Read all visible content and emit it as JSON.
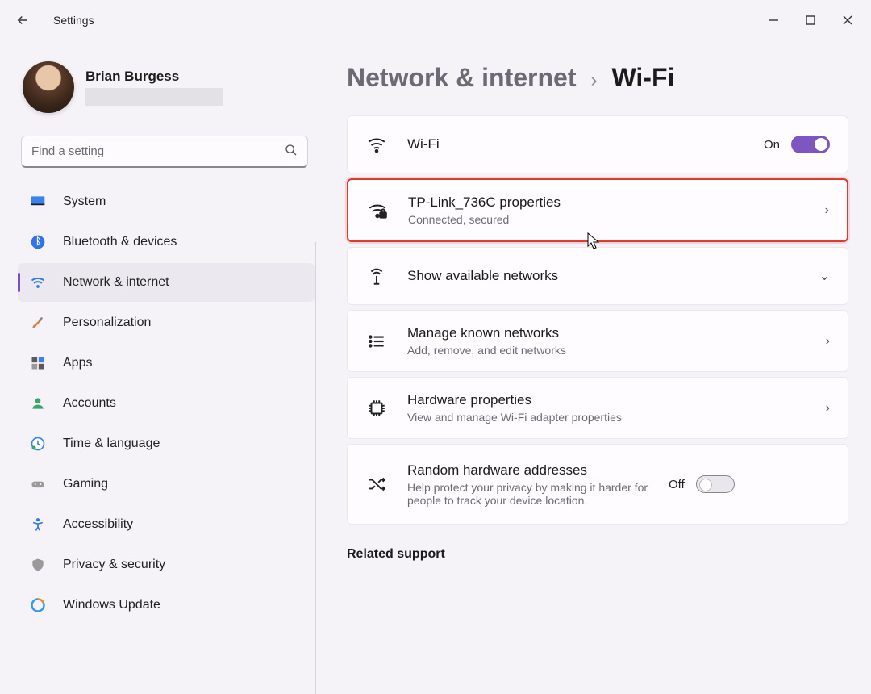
{
  "window": {
    "title": "Settings"
  },
  "profile": {
    "name": "Brian Burgess"
  },
  "search": {
    "placeholder": "Find a setting"
  },
  "sidebar": {
    "items": [
      {
        "label": "System"
      },
      {
        "label": "Bluetooth & devices"
      },
      {
        "label": "Network & internet"
      },
      {
        "label": "Personalization"
      },
      {
        "label": "Apps"
      },
      {
        "label": "Accounts"
      },
      {
        "label": "Time & language"
      },
      {
        "label": "Gaming"
      },
      {
        "label": "Accessibility"
      },
      {
        "label": "Privacy & security"
      },
      {
        "label": "Windows Update"
      }
    ],
    "active_index": 2
  },
  "breadcrumb": {
    "parent": "Network & internet",
    "current": "Wi-Fi"
  },
  "cards": {
    "wifi": {
      "title": "Wi-Fi",
      "state_label": "On",
      "state_on": true
    },
    "network": {
      "title": "TP-Link_736C properties",
      "subtitle": "Connected, secured"
    },
    "available": {
      "title": "Show available networks"
    },
    "known": {
      "title": "Manage known networks",
      "subtitle": "Add, remove, and edit networks"
    },
    "hardware": {
      "title": "Hardware properties",
      "subtitle": "View and manage Wi-Fi adapter properties"
    },
    "random": {
      "title": "Random hardware addresses",
      "subtitle": "Help protect your privacy by making it harder for people to track your device location.",
      "state_label": "Off",
      "state_on": false
    }
  },
  "related": {
    "heading": "Related support"
  }
}
